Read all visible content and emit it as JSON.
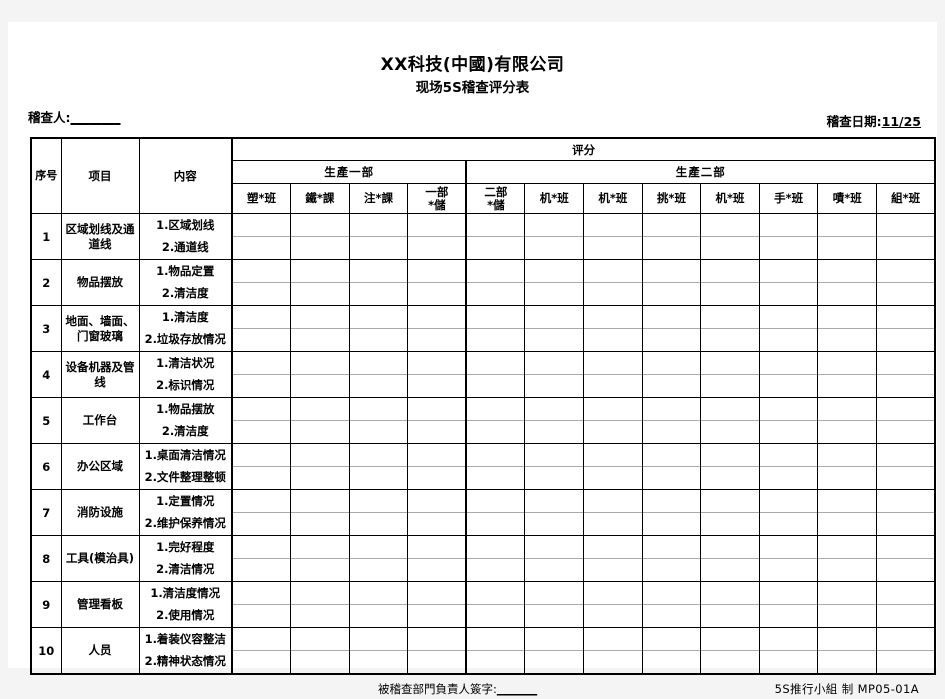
{
  "header": {
    "company_title": "XX科技(中國)有限公司",
    "form_title": "现场5S稽查评分表",
    "auditor_label": "稽查人:",
    "auditor_value": "________",
    "date_label": "稽查日期:",
    "date_value": "11/25"
  },
  "table": {
    "col_no": "序号",
    "col_item": "项目",
    "col_detail": "内容",
    "score_band": "评分",
    "groups": [
      {
        "name": "生產一部",
        "columns": [
          "塑*班",
          "鐵*課",
          "注*課",
          "一部\n*儲"
        ]
      },
      {
        "name": "生產二部",
        "columns": [
          "二部\n*儲",
          "机*班",
          "机*班",
          "挑*班",
          "机*班",
          "手*班",
          "嘖*班",
          "組*班"
        ]
      }
    ],
    "rows": [
      {
        "no": "1",
        "item": "区域划线及通道线",
        "detail1": "1.区域划线",
        "detail2": "2.通道线"
      },
      {
        "no": "2",
        "item": "物品摆放",
        "detail1": "1.物品定置",
        "detail2": "2.清洁度"
      },
      {
        "no": "3",
        "item": "地面、墙面、门窗玻璃",
        "detail1": "1.清洁度",
        "detail2": "2.垃圾存放情况"
      },
      {
        "no": "4",
        "item": "设备机器及管线",
        "detail1": "1.清洁状况",
        "detail2": "2.标识情况"
      },
      {
        "no": "5",
        "item": "工作台",
        "detail1": "1.物品摆放",
        "detail2": "2.清洁度"
      },
      {
        "no": "6",
        "item": "办公区域",
        "detail1": "1.桌面清洁情况",
        "detail2": "2.文件整理整顿"
      },
      {
        "no": "7",
        "item": "消防设施",
        "detail1": "1.定置情况",
        "detail2": "2.维护保养情况"
      },
      {
        "no": "8",
        "item": "工具(模治具)",
        "detail1": "1.完好程度",
        "detail2": "2.清洁情况"
      },
      {
        "no": "9",
        "item": "管理看板",
        "detail1": "1.清洁度情况",
        "detail2": "2.使用情况"
      },
      {
        "no": "10",
        "item": "人员",
        "detail1": "1.着装仪容整洁",
        "detail2": "2.精神状态情况"
      }
    ]
  },
  "footer": {
    "signature_label": "被稽查部門負責人簽字:",
    "signature_value": "_______",
    "issuer": "5S推行小組  制  MP05-01A"
  }
}
